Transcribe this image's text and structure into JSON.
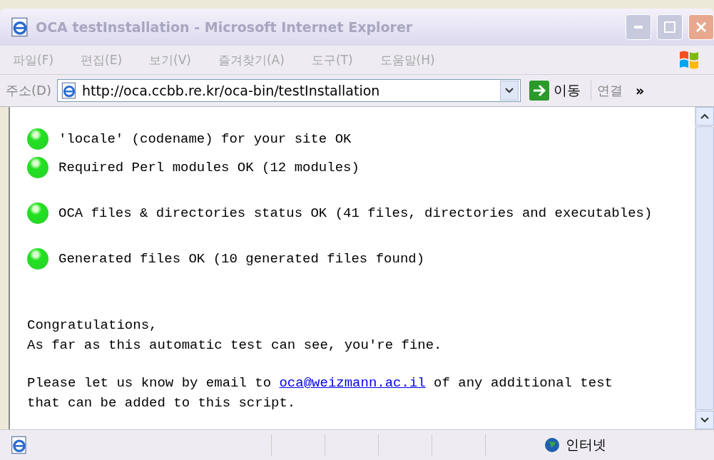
{
  "window": {
    "title": "OCA testInstallation - Microsoft Internet Explorer"
  },
  "menu": [
    {
      "label": "파일(F)"
    },
    {
      "label": "편집(E)"
    },
    {
      "label": "보기(V)"
    },
    {
      "label": "즐겨찾기(A)"
    },
    {
      "label": "도구(T)"
    },
    {
      "label": "도움말(H)"
    }
  ],
  "address_bar": {
    "label": "주소(D)",
    "value": "http://oca.ccbb.re.kr/oca-bin/testInstallation",
    "go_button": "이동",
    "links": "연결",
    "more": "»"
  },
  "checks": [
    {
      "text": "'locale' (codename) for your site OK"
    },
    {
      "text": "Required Perl modules OK (12 modules)"
    },
    {
      "text": "OCA files & directories status OK (41 files, directories and executables)"
    },
    {
      "text": "Generated files OK (10 generated files found)"
    }
  ],
  "message": [
    "Congratulations,",
    "As far as this automatic test can see, you're fine."
  ],
  "contact": {
    "before": "Please let us know by email to",
    "link": "oca@weizmann.ac.il",
    "after": "of any additional test",
    "line2": "that can be added to this script."
  },
  "status_bar": {
    "zone": "인터넷"
  }
}
